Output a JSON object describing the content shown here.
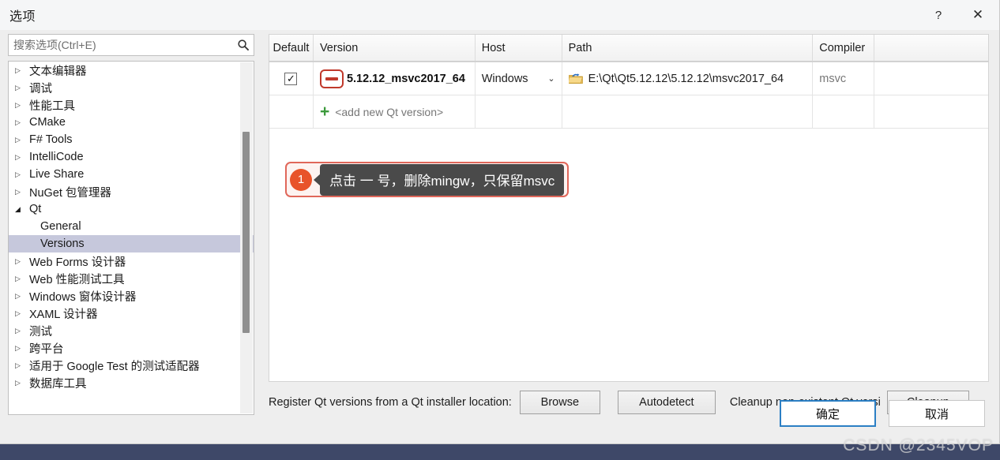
{
  "window": {
    "title": "选项",
    "help_icon": "?",
    "close_icon": "✕"
  },
  "search": {
    "placeholder": "搜索选项(Ctrl+E)",
    "value": "",
    "icon": "search-icon"
  },
  "tree": {
    "items": [
      {
        "label": "文本编辑器",
        "level": 0,
        "state": "collapsed",
        "selected": false
      },
      {
        "label": "调试",
        "level": 0,
        "state": "collapsed",
        "selected": false
      },
      {
        "label": "性能工具",
        "level": 0,
        "state": "collapsed",
        "selected": false
      },
      {
        "label": "CMake",
        "level": 0,
        "state": "collapsed",
        "selected": false
      },
      {
        "label": "F# Tools",
        "level": 0,
        "state": "collapsed",
        "selected": false
      },
      {
        "label": "IntelliCode",
        "level": 0,
        "state": "collapsed",
        "selected": false
      },
      {
        "label": "Live Share",
        "level": 0,
        "state": "collapsed",
        "selected": false
      },
      {
        "label": "NuGet 包管理器",
        "level": 0,
        "state": "collapsed",
        "selected": false
      },
      {
        "label": "Qt",
        "level": 0,
        "state": "expanded",
        "selected": false
      },
      {
        "label": "General",
        "level": 1,
        "state": "leaf",
        "selected": false
      },
      {
        "label": "Versions",
        "level": 1,
        "state": "leaf",
        "selected": true
      },
      {
        "label": "Web Forms 设计器",
        "level": 0,
        "state": "collapsed",
        "selected": false
      },
      {
        "label": "Web 性能测试工具",
        "level": 0,
        "state": "collapsed",
        "selected": false
      },
      {
        "label": "Windows 窗体设计器",
        "level": 0,
        "state": "collapsed",
        "selected": false
      },
      {
        "label": "XAML 设计器",
        "level": 0,
        "state": "collapsed",
        "selected": false
      },
      {
        "label": "测试",
        "level": 0,
        "state": "collapsed",
        "selected": false
      },
      {
        "label": "跨平台",
        "level": 0,
        "state": "collapsed",
        "selected": false
      },
      {
        "label": "适用于 Google Test 的测试适配器",
        "level": 0,
        "state": "collapsed",
        "selected": false
      },
      {
        "label": "数据库工具",
        "level": 0,
        "state": "collapsed",
        "selected": false
      }
    ],
    "collapsed_glyph": "▷",
    "expanded_glyph": "◢"
  },
  "grid": {
    "headers": [
      "Default",
      "Version",
      "Host",
      "Path",
      "Compiler",
      ""
    ],
    "rows": [
      {
        "default_checked": "✓",
        "remove_icon": "minus-icon",
        "version": "5.12.12_msvc2017_64",
        "host": "Windows",
        "host_chevron": "⌄",
        "path_icon": "folder-browse-icon",
        "path": "E:\\Qt\\Qt5.12.12\\5.12.12\\msvc2017_64",
        "compiler": "msvc",
        "extra": ""
      }
    ],
    "add_row": {
      "plus": "+",
      "label": "<add new Qt version>"
    }
  },
  "annotation": {
    "badge": "1",
    "text": "点击 一 号，删除mingw，只保留msvc",
    "badge_color": "#e8532a",
    "border_color": "#e0675a",
    "bubble_color": "#4a4a4a"
  },
  "register_row": {
    "label": "Register Qt versions from a Qt installer location:",
    "browse": "Browse",
    "autodetect": "Autodetect",
    "cleanup_label": "Cleanup non-existent Qt versi",
    "cleanup": "Cleanup"
  },
  "footer": {
    "ok": "确定",
    "cancel": "取消"
  },
  "watermark": "CSDN @2345VOP",
  "colors": {
    "accent": "#2b7fc4",
    "danger": "#c0392b",
    "add": "#3c9a3c",
    "selection": "#c6c8dc"
  }
}
